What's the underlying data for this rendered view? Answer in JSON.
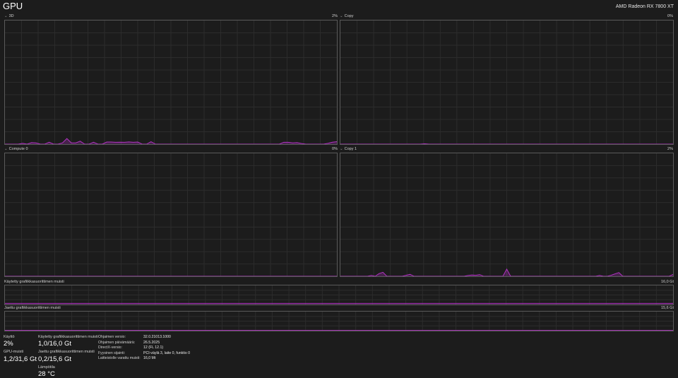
{
  "header": {
    "title": "GPU",
    "gpu_name": "AMD Radeon RX 7800 XT"
  },
  "colors": {
    "accent": "#b233c4",
    "grid": "#2c2c2c",
    "border": "#5a5a5a",
    "background": "#1c1c1c"
  },
  "engines": [
    {
      "label": "3D",
      "percent": "2%",
      "series": [
        0,
        0,
        0,
        0,
        0.6,
        0,
        1.2,
        1.0,
        0,
        0,
        1.5,
        0,
        0,
        1.0,
        4.5,
        1.0,
        1.0,
        2.4,
        0,
        0,
        1.5,
        0,
        0,
        1.7,
        1.7,
        1.5,
        1.6,
        1.5,
        1.8,
        1.5,
        1.7,
        0,
        0,
        2.0,
        0,
        0,
        0,
        0,
        0,
        0,
        0,
        0,
        0,
        0,
        0,
        0,
        0,
        0,
        0,
        0,
        0,
        0,
        0,
        0,
        0,
        0,
        0,
        0,
        0,
        0,
        0,
        0,
        0,
        1.5,
        1.5,
        1.0,
        1.2,
        0.5,
        0,
        0,
        0,
        0,
        0,
        0.6,
        1.6,
        2.0
      ]
    },
    {
      "label": "Copy",
      "percent": "0%",
      "series": [
        0,
        0,
        0,
        0,
        0,
        0,
        0,
        0,
        0,
        0,
        0,
        0,
        0,
        0,
        0,
        0,
        0,
        0,
        0,
        0.3,
        0,
        0,
        0,
        0,
        0,
        0,
        0,
        0,
        0,
        0,
        0,
        0,
        0,
        0,
        0,
        0,
        0,
        0,
        0,
        0,
        0,
        0,
        0,
        0,
        0,
        0,
        0,
        0,
        0,
        0,
        0,
        0,
        0,
        0,
        0,
        0,
        0,
        0,
        0,
        0,
        0,
        0,
        0,
        0,
        0,
        0,
        0,
        0,
        0,
        0,
        0,
        0,
        0,
        0,
        0,
        0
      ]
    },
    {
      "label": "Compute 0",
      "percent": "0%",
      "series": [
        0,
        0,
        0,
        0,
        0,
        0,
        0,
        0,
        0,
        0,
        0,
        0,
        0,
        0,
        0,
        0,
        0,
        0,
        0,
        0,
        0,
        0,
        0,
        0,
        0,
        0,
        0,
        0,
        0,
        0,
        0,
        0,
        0,
        0,
        0,
        0,
        0,
        0,
        0,
        0,
        0,
        0,
        0,
        0,
        0,
        0,
        0,
        0,
        0,
        0,
        0,
        0,
        0,
        0,
        0,
        0,
        0,
        0,
        0,
        0,
        0,
        0,
        0,
        0,
        0,
        0,
        0,
        0,
        0,
        0,
        0,
        0,
        0,
        0,
        0,
        0
      ]
    },
    {
      "label": "Copy 1",
      "percent": "2%",
      "series": [
        0,
        0,
        0,
        0,
        0,
        0,
        0,
        0,
        0.6,
        0,
        2.2,
        3.2,
        0,
        0,
        0,
        0,
        0,
        0.8,
        1.6,
        0,
        0,
        0,
        0,
        0,
        0,
        0,
        0,
        0,
        0,
        0,
        0,
        0,
        0,
        0.6,
        1.0,
        0.8,
        1.3,
        0,
        0,
        0,
        0,
        0,
        0,
        5.8,
        0,
        0,
        0,
        0,
        0,
        0,
        0,
        0,
        0,
        0,
        0,
        0,
        0,
        0,
        0,
        0,
        0,
        0,
        0,
        0,
        0,
        0,
        0,
        0.6,
        0,
        0,
        0.8,
        2.0,
        3.0,
        0,
        0,
        0,
        0,
        0,
        0,
        0,
        0,
        0,
        0,
        0,
        0,
        0,
        1.5
      ]
    }
  ],
  "memory_graphs": [
    {
      "label": "Käytetty grafiikkasuorittimen muisti",
      "max": "16,0 Gt",
      "series": [
        6.2,
        6.2,
        6.2,
        6.2,
        6.2,
        6.2,
        6.2,
        6.2,
        6.2,
        6.2,
        6.2,
        6.2,
        6.2,
        6.2,
        6.3,
        6.3,
        6.3,
        6.3,
        6.3,
        6.2,
        6.2,
        6.2,
        6.2,
        6.2,
        6.2,
        6.2,
        6.2,
        6.2,
        6.2,
        6.2,
        6.2,
        6.2,
        6.2,
        6.2,
        6.2,
        6.2,
        6.2,
        6.2,
        6.2,
        6.2,
        6.2,
        6.2,
        6.2,
        6.2,
        6.2,
        6.2,
        6.2,
        6.2,
        6.2,
        6.2
      ]
    },
    {
      "label": "Jaettu grafiikkasuorittimen muisti",
      "max": "15,6 Gt",
      "series": [
        1.3,
        1.3,
        1.3,
        1.3,
        1.3,
        1.3,
        1.3,
        1.3,
        1.3,
        1.3,
        1.3,
        1.3,
        1.3,
        1.3,
        1.3,
        1.3,
        1.3,
        1.3,
        1.3,
        1.3,
        1.3,
        1.3,
        1.3,
        1.3,
        1.3,
        1.3,
        1.3,
        1.3,
        1.3,
        1.3,
        1.3,
        1.3,
        1.3,
        1.3,
        1.3,
        1.3,
        1.3,
        1.3,
        1.3,
        1.3,
        1.3,
        1.3,
        1.3,
        1.3,
        1.3,
        1.3,
        1.3,
        1.3,
        1.3,
        1.3
      ]
    }
  ],
  "stats": {
    "utilization_label": "Käyttö",
    "utilization_value": "2%",
    "gpu_memory_label": "GPU-muisti",
    "gpu_memory_value": "1,2/31,6 Gt",
    "dedicated_label": "Käytetty grafiikkasuorittimen muisti",
    "dedicated_value": "1,0/16,0 Gt",
    "shared_label": "Jaettu grafiikkasuorittimen muisti",
    "shared_value": "0,2/15,6 Gt",
    "temperature_label": "Lämpötila",
    "temperature_value": "28 °C"
  },
  "properties": [
    {
      "key": "Ohjaimen versio:",
      "value": "32.0.21013.1000"
    },
    {
      "key": "Ohjaimen päivämäärä:",
      "value": "26.5.2025"
    },
    {
      "key": "DirectX-versio:",
      "value": "12 (FL 12.1)"
    },
    {
      "key": "Fyysinen sijainti:",
      "value": "PCI-väylä 3, laite 0, funktio 0"
    },
    {
      "key": "Laitteistolle varattu muisti:",
      "value": "16,0 Mt"
    }
  ]
}
